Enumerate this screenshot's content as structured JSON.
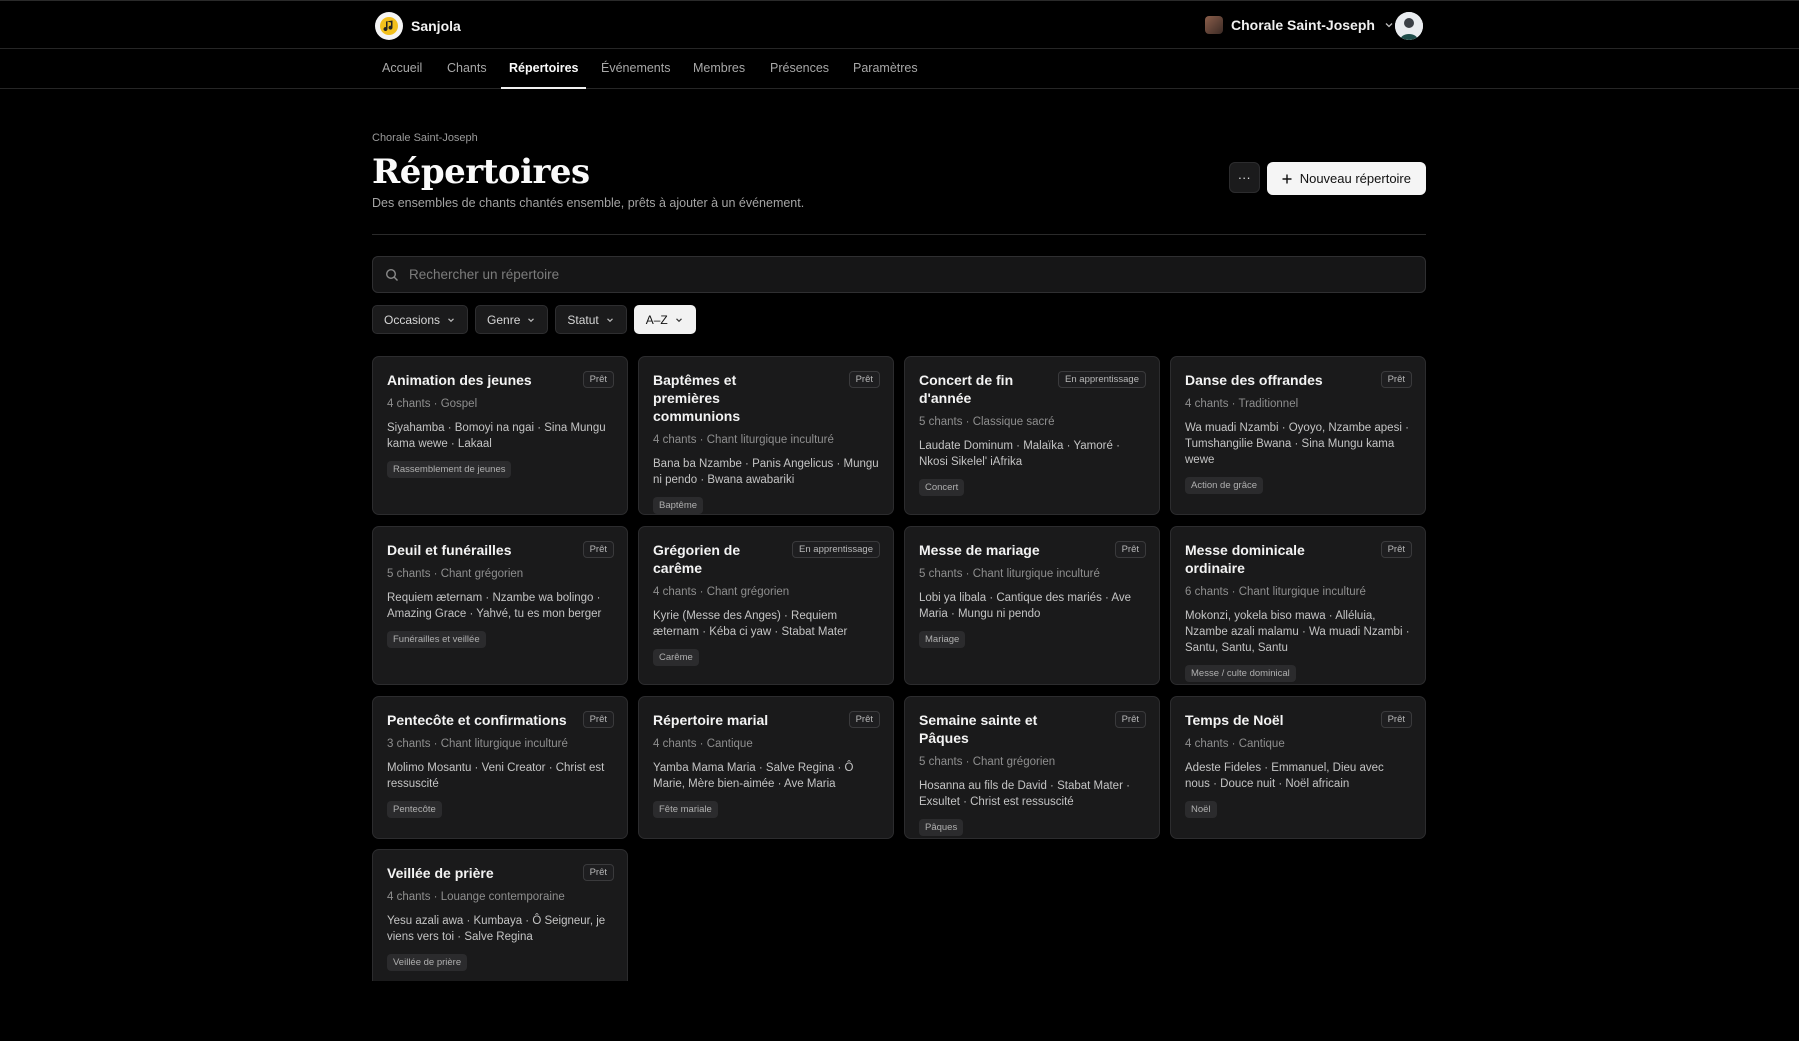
{
  "app": {
    "name": "Sanjola",
    "organization": "Chorale Saint-Joseph"
  },
  "nav": {
    "items": [
      {
        "label": "Accueil",
        "active": false
      },
      {
        "label": "Chants",
        "active": false
      },
      {
        "label": "Répertoires",
        "active": true
      },
      {
        "label": "Événements",
        "active": false
      },
      {
        "label": "Membres",
        "active": false
      },
      {
        "label": "Présences",
        "active": false
      },
      {
        "label": "Paramètres",
        "active": false
      }
    ]
  },
  "header": {
    "breadcrumb": "Chorale Saint-Joseph",
    "title": "Répertoires",
    "subtitle": "Des ensembles de chants chantés ensemble, prêts à ajouter à un événement.",
    "more_label": "···",
    "new_label": "Nouveau répertoire"
  },
  "search": {
    "placeholder": "Rechercher un répertoire"
  },
  "filters": [
    {
      "label": "Occasions",
      "active": false
    },
    {
      "label": "Genre",
      "active": false
    },
    {
      "label": "Statut",
      "active": false
    },
    {
      "label": "A–Z",
      "active": true
    }
  ],
  "cards": [
    {
      "title": "Animation des jeunes",
      "status": "Prêt",
      "meta": "4 chants · Gospel",
      "songs": "Siyahamba · Bomoyi na ngai · Sina Mungu kama wewe · Lakaal",
      "tag": "Rassemblement de jeunes"
    },
    {
      "title": "Baptêmes et premières communions",
      "status": "Prêt",
      "meta": "4 chants · Chant liturgique inculturé",
      "songs": "Bana ba Nzambe · Panis Angelicus · Mungu ni pendo · Bwana awabariki",
      "tag": "Baptême"
    },
    {
      "title": "Concert de fin d'année",
      "status": "En apprentissage",
      "meta": "5 chants · Classique sacré",
      "songs": "Laudate Dominum · Malaïka · Yamoré · Nkosi Sikelel' iAfrika",
      "tag": "Concert"
    },
    {
      "title": "Danse des offrandes",
      "status": "Prêt",
      "meta": "4 chants · Traditionnel",
      "songs": "Wa muadi Nzambi · Oyoyo, Nzambe apesi · Tumshangilie Bwana · Sina Mungu kama wewe",
      "tag": "Action de grâce"
    },
    {
      "title": "Deuil et funérailles",
      "status": "Prêt",
      "meta": "5 chants · Chant grégorien",
      "songs": "Requiem æternam · Nzambe wa bolingo · Amazing Grace · Yahvé, tu es mon berger",
      "tag": "Funérailles et veillée"
    },
    {
      "title": "Grégorien de carême",
      "status": "En apprentissage",
      "meta": "4 chants · Chant grégorien",
      "songs": "Kyrie (Messe des Anges) · Requiem æternam · Kéba ci yaw · Stabat Mater",
      "tag": "Carême"
    },
    {
      "title": "Messe de mariage",
      "status": "Prêt",
      "meta": "5 chants · Chant liturgique inculturé",
      "songs": "Lobi ya libala · Cantique des mariés · Ave Maria · Mungu ni pendo",
      "tag": "Mariage"
    },
    {
      "title": "Messe dominicale ordinaire",
      "status": "Prêt",
      "meta": "6 chants · Chant liturgique inculturé",
      "songs": "Mokonzi, yokela biso mawa · Alléluia, Nzambe azali malamu · Wa muadi Nzambi · Santu, Santu, Santu",
      "tag": "Messe / culte dominical"
    },
    {
      "title": "Pentecôte et confirmations",
      "status": "Prêt",
      "meta": "3 chants · Chant liturgique inculturé",
      "songs": "Molimo Mosantu · Veni Creator · Christ est ressuscité",
      "tag": "Pentecôte"
    },
    {
      "title": "Répertoire marial",
      "status": "Prêt",
      "meta": "4 chants · Cantique",
      "songs": "Yamba Mama Maria · Salve Regina · Ô Marie, Mère bien-aimée · Ave Maria",
      "tag": "Fête mariale"
    },
    {
      "title": "Semaine sainte et Pâques",
      "status": "Prêt",
      "meta": "5 chants · Chant grégorien",
      "songs": "Hosanna au fils de David · Stabat Mater · Exsultet · Christ est ressuscité",
      "tag": "Pâques"
    },
    {
      "title": "Temps de Noël",
      "status": "Prêt",
      "meta": "4 chants · Cantique",
      "songs": "Adeste Fideles · Emmanuel, Dieu avec nous · Douce nuit · Noël africain",
      "tag": "Noël"
    },
    {
      "title": "Veillée de prière",
      "status": "Prêt",
      "meta": "4 chants · Louange contemporaine",
      "songs": "Yesu azali awa · Kumbaya · Ô Seigneur, je viens vers toi · Salve Regina",
      "tag": "Veillée de prière"
    }
  ]
}
